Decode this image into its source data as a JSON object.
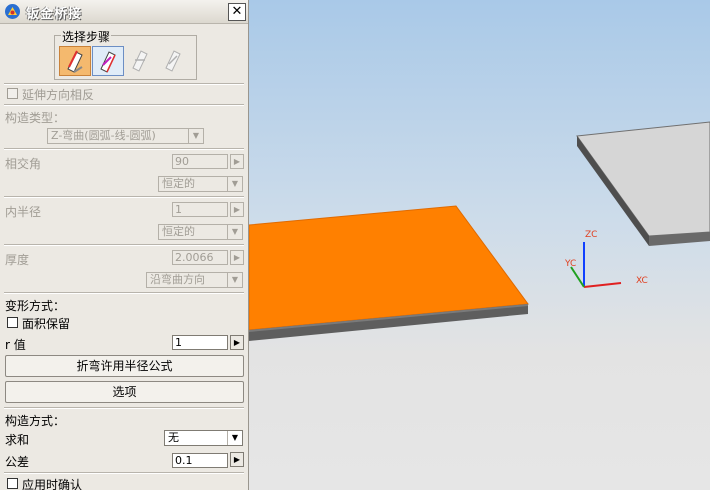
{
  "window": {
    "title": "钣金桥接",
    "close_symbol": "✕"
  },
  "steps": {
    "group_label": "选择步骤",
    "items": [
      {
        "name": "step-1-icon",
        "state": "active"
      },
      {
        "name": "step-2-icon",
        "state": "current"
      },
      {
        "name": "step-3-icon",
        "state": "disabled"
      },
      {
        "name": "step-4-icon",
        "state": "disabled"
      }
    ]
  },
  "reverse_extension": {
    "label": "延伸方向相反",
    "checked": false
  },
  "construction_type": {
    "label": "构造类型：",
    "value": "Z-弯曲(圆弧-线-圆弧)"
  },
  "intersect_angle": {
    "label": "相交角",
    "value": "90",
    "mode": "恒定的"
  },
  "inner_radius": {
    "label": "内半径",
    "value": "1",
    "mode": "恒定的"
  },
  "thickness": {
    "label": "厚度",
    "value": "2.0066",
    "mode": "沿弯曲方向"
  },
  "deformation": {
    "label": "变形方式：",
    "area_preserve": {
      "label": "面积保留",
      "checked": false
    },
    "r_value": {
      "label": "r 值",
      "value": "1"
    },
    "formula_button": "折弯许用半径公式",
    "options_button": "选项"
  },
  "construction_method": {
    "label": "构造方式：",
    "sum": {
      "label": "求和",
      "value": "无"
    },
    "tolerance": {
      "label": "公差",
      "value": "0.1"
    }
  },
  "confirm_on_apply": {
    "label": "应用时确认",
    "checked": false
  },
  "axes": {
    "zc": "ZC",
    "yc": "YC",
    "xc": "XC"
  },
  "colors": {
    "orange_plate": "#ff8000",
    "gray_plate": "#d8d8d8",
    "axis_z": "#1040ff",
    "axis_x": "#e02020",
    "axis_y": "#20a020"
  }
}
